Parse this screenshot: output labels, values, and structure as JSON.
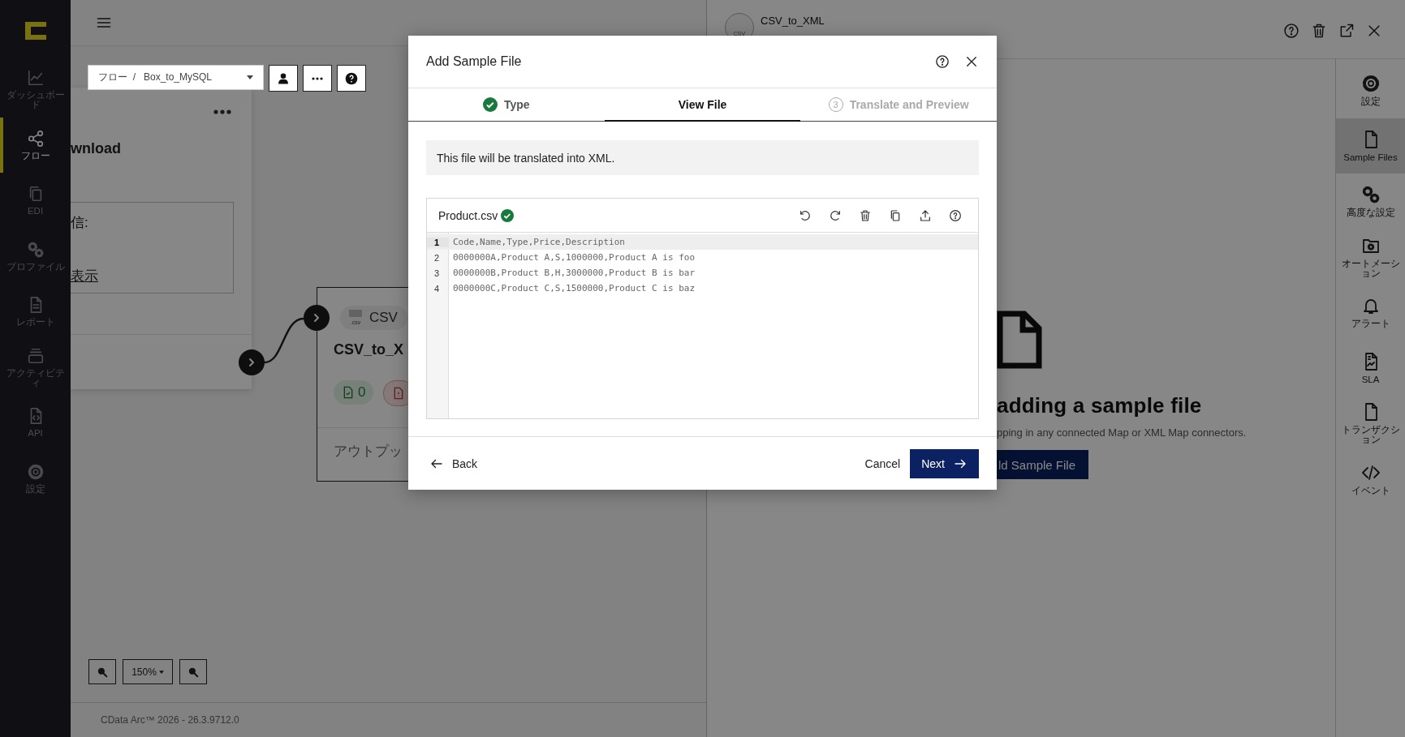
{
  "sidebar": {
    "items": [
      {
        "label": "ダッシュボード",
        "selected": false
      },
      {
        "label": "フロー",
        "selected": true
      },
      {
        "label": "EDI",
        "selected": false
      },
      {
        "label": "プロファイル",
        "selected": false
      },
      {
        "label": "レポート",
        "selected": false
      },
      {
        "label": "アクティビティ",
        "selected": false
      },
      {
        "label": "API",
        "selected": false
      },
      {
        "label": "設定",
        "selected": false
      }
    ]
  },
  "canvas": {
    "breadcrumb": "フロー  /   Box_to_MySQL",
    "source_card": {
      "title": "wnload",
      "field_label": "信:",
      "link": "表示"
    },
    "node": {
      "file_type": ".csv",
      "type_label": "CSV",
      "title": "CSV_to_X",
      "badges": [
        {
          "kind": "success",
          "count": "0"
        },
        {
          "kind": "error"
        }
      ],
      "output_label": "アウトプッ"
    },
    "zoom_level": "150%",
    "footer": "CData Arc™ 2026 - 26.3.9712.0"
  },
  "panel": {
    "avatar_label": "CSV",
    "title": "CSV_to_XML",
    "empty_state": {
      "heading": "adding a sample file",
      "description": "pping in any connected Map or XML Map connectors.",
      "button": "ld Sample File"
    },
    "rail": [
      {
        "label": "設定",
        "selected": false
      },
      {
        "label": "Sample Files",
        "selected": true
      },
      {
        "label": "高度な設定",
        "selected": false
      },
      {
        "label": "オートメーション",
        "selected": false
      },
      {
        "label": "アラート",
        "selected": false
      },
      {
        "label": "SLA",
        "selected": false
      },
      {
        "label": "トランザクション",
        "selected": false
      },
      {
        "label": "イベント",
        "selected": false
      }
    ]
  },
  "dialog": {
    "title": "Add Sample File",
    "steps": [
      {
        "label": "Type",
        "kind": "done",
        "selected": false
      },
      {
        "label": "View File",
        "kind": "current",
        "selected": true
      },
      {
        "label": "Translate and Preview",
        "number": "3",
        "kind": "pending",
        "selected": false
      }
    ],
    "info": "This file will be translated into XML.",
    "editor": {
      "file_name": "Product.csv",
      "valid": true,
      "lines": [
        {
          "number": "1",
          "text": "Code,Name,Type,Price,Description",
          "current": true
        },
        {
          "number": "2",
          "text": "0000000A,Product A,S,1000000,Product A is foo",
          "current": false
        },
        {
          "number": "3",
          "text": "0000000B,Product B,H,3000000,Product B is bar",
          "current": false
        },
        {
          "number": "4",
          "text": "0000000C,Product C,S,1500000,Product C is baz",
          "current": false
        }
      ]
    },
    "back": "Back",
    "cancel": "Cancel",
    "next": "Next"
  }
}
